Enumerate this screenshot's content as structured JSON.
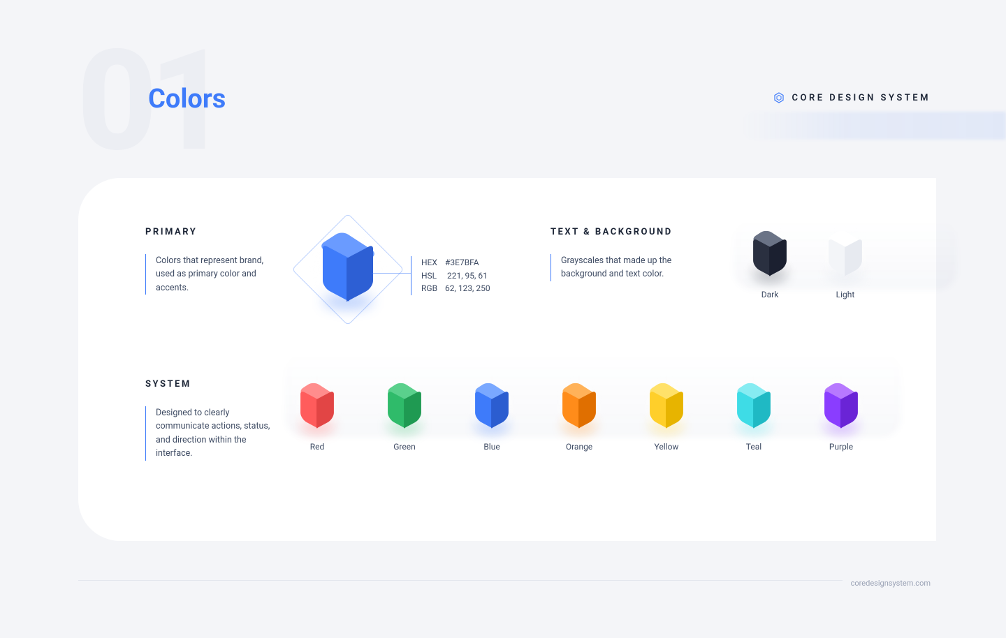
{
  "page_number": "01",
  "page_title": "Colors",
  "brand_label": "CORE DESIGN SYSTEM",
  "footer_url": "coredesignsystem.com",
  "sections": {
    "primary": {
      "title": "PRIMARY",
      "description": "Colors that represent brand, used as primary color and accents.",
      "spec": {
        "hex_label": "HEX",
        "hex_value": "#3E7BFA",
        "hsl_label": "HSL",
        "hsl_value": "221, 95, 61",
        "rgb_label": "RGB",
        "rgb_value": "62, 123, 250"
      },
      "cube_colors": {
        "top": "#6a9bff",
        "left": "#3e7bfa",
        "right": "#2d5fd4",
        "shadow": "#3e7bfa"
      }
    },
    "text_bg": {
      "title": "TEXT & BACKGROUND",
      "description": "Grayscales that made up the background and text color.",
      "swatches": [
        {
          "label": "Dark",
          "top": "#6a7386",
          "left": "#2a3040",
          "right": "#1b2030",
          "shadow": "#2a3040"
        },
        {
          "label": "Light",
          "top": "#ffffff",
          "left": "#f3f5f8",
          "right": "#e7eaf0",
          "shadow": "#cfd6e3"
        }
      ]
    },
    "system": {
      "title": "SYSTEM",
      "description": "Designed to clearly communicate actions, status, and direction within the interface.",
      "swatches": [
        {
          "label": "Red",
          "top": "#ff8d8d",
          "left": "#ff5c5c",
          "right": "#e24545",
          "shadow": "#ff5c5c"
        },
        {
          "label": "Green",
          "top": "#5ad08c",
          "left": "#2fbb6a",
          "right": "#1f9a52",
          "shadow": "#2fbb6a"
        },
        {
          "label": "Blue",
          "top": "#7aa8ff",
          "left": "#3e7bfa",
          "right": "#2b5dd0",
          "shadow": "#3e7bfa"
        },
        {
          "label": "Orange",
          "top": "#ffb259",
          "left": "#ff8c1a",
          "right": "#e06f00",
          "shadow": "#ff8c1a"
        },
        {
          "label": "Yellow",
          "top": "#ffe169",
          "left": "#ffcf2a",
          "right": "#e7b400",
          "shadow": "#ffcf2a"
        },
        {
          "label": "Teal",
          "top": "#86ecf2",
          "left": "#3edce6",
          "right": "#1fb9c4",
          "shadow": "#3edce6"
        },
        {
          "label": "Purple",
          "top": "#b779ff",
          "left": "#8a3dff",
          "right": "#6a24d6",
          "shadow": "#8a3dff"
        }
      ]
    }
  }
}
